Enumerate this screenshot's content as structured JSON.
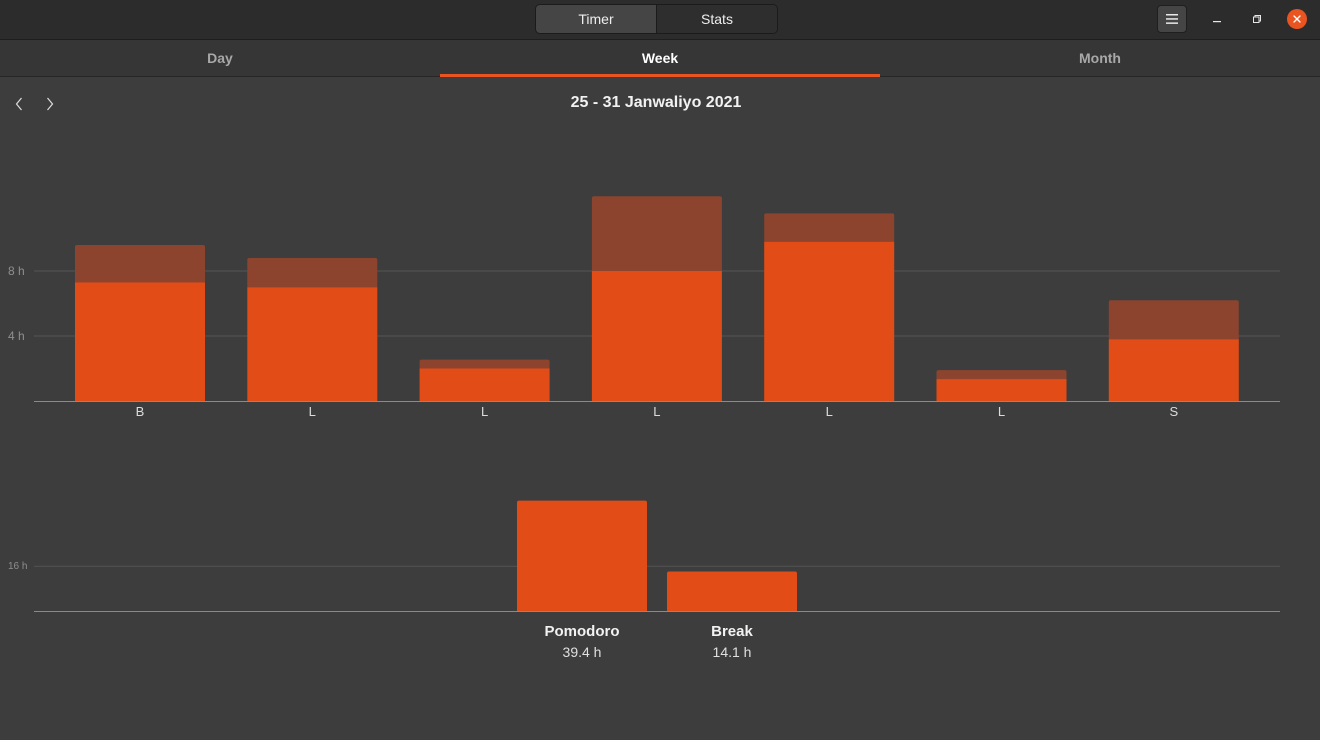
{
  "header": {
    "switcher": [
      {
        "label": "Timer",
        "active": true
      },
      {
        "label": "Stats",
        "active": false
      }
    ],
    "menu_icon": "hamburger-menu-icon",
    "window_controls": [
      "minimize-icon",
      "maximize-icon",
      "close-icon"
    ]
  },
  "tabs": [
    {
      "label": "Day",
      "active": false
    },
    {
      "label": "Week",
      "active": true
    },
    {
      "label": "Month",
      "active": false
    }
  ],
  "navigation": {
    "prev_icon": "chevron-left-icon",
    "next_icon": "chevron-right-icon",
    "period": "25 - 31 Janwaliyo 2021"
  },
  "colors": {
    "accent": "#e95420",
    "pomodoro_bar": "#e24c17",
    "break_bar": "#8c442e",
    "background": "#3d3d3d"
  },
  "chart_data": [
    {
      "type": "bar",
      "stacked": true,
      "categories": [
        "B",
        "L",
        "L",
        "L",
        "L",
        "L",
        "S"
      ],
      "series": [
        {
          "values": [
            7.3,
            7.0,
            2.0,
            8.0,
            9.8,
            1.35,
            3.8
          ]
        },
        {
          "values": [
            2.3,
            1.8,
            0.55,
            4.6,
            1.75,
            0.55,
            2.4
          ]
        }
      ],
      "y_ticks": [
        {
          "value": 4,
          "label": "4 h"
        },
        {
          "value": 8,
          "label": "8 h"
        }
      ],
      "ylim": [
        0,
        14
      ]
    },
    {
      "type": "bar",
      "categories": [
        "Pomodoro",
        "Break"
      ],
      "values": [
        39.4,
        14.1
      ],
      "value_labels": [
        "39.4 h",
        "14.1 h"
      ],
      "y_ticks": [
        {
          "value": 16,
          "label": "16 h"
        }
      ],
      "ylim": [
        0,
        40
      ]
    }
  ]
}
